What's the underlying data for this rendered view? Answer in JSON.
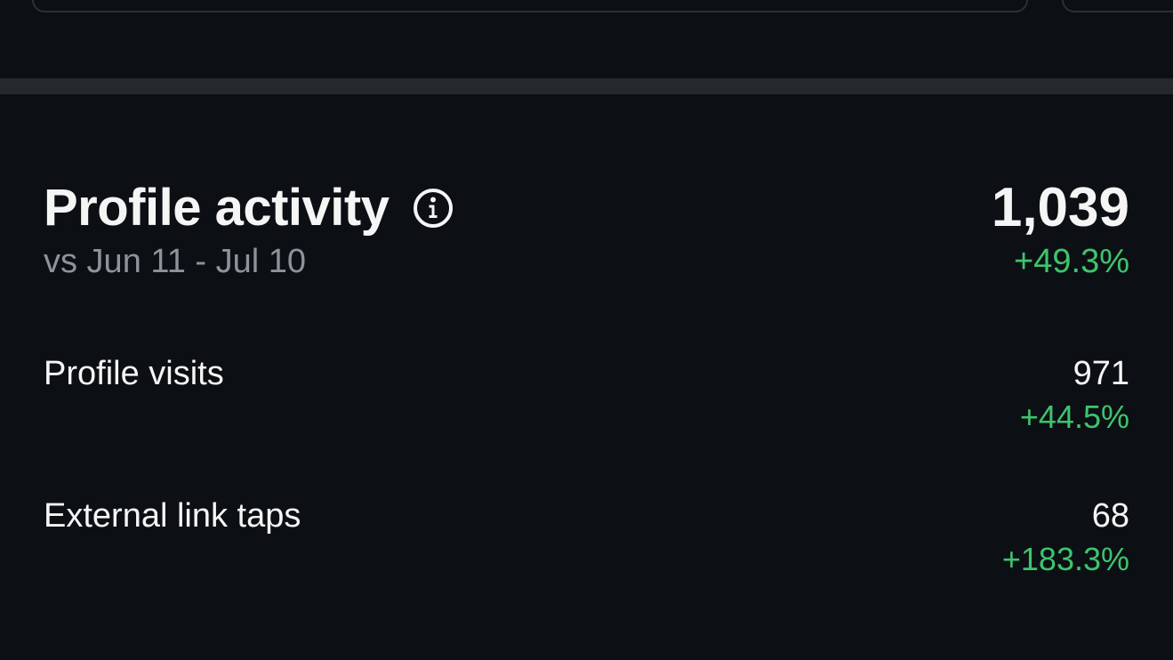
{
  "profile_activity": {
    "title": "Profile activity",
    "info_icon": "info-icon",
    "comparison_period": "vs Jun 11 - Jul 10",
    "total": "1,039",
    "total_change": "+49.3%",
    "metrics": [
      {
        "label": "Profile visits",
        "value": "971",
        "change": "+44.5%"
      },
      {
        "label": "External link taps",
        "value": "68",
        "change": "+183.3%"
      }
    ]
  },
  "colors": {
    "background": "#0c1014",
    "positive": "#3ec46d",
    "secondary_text": "#8e9399",
    "divider": "#25292e"
  }
}
